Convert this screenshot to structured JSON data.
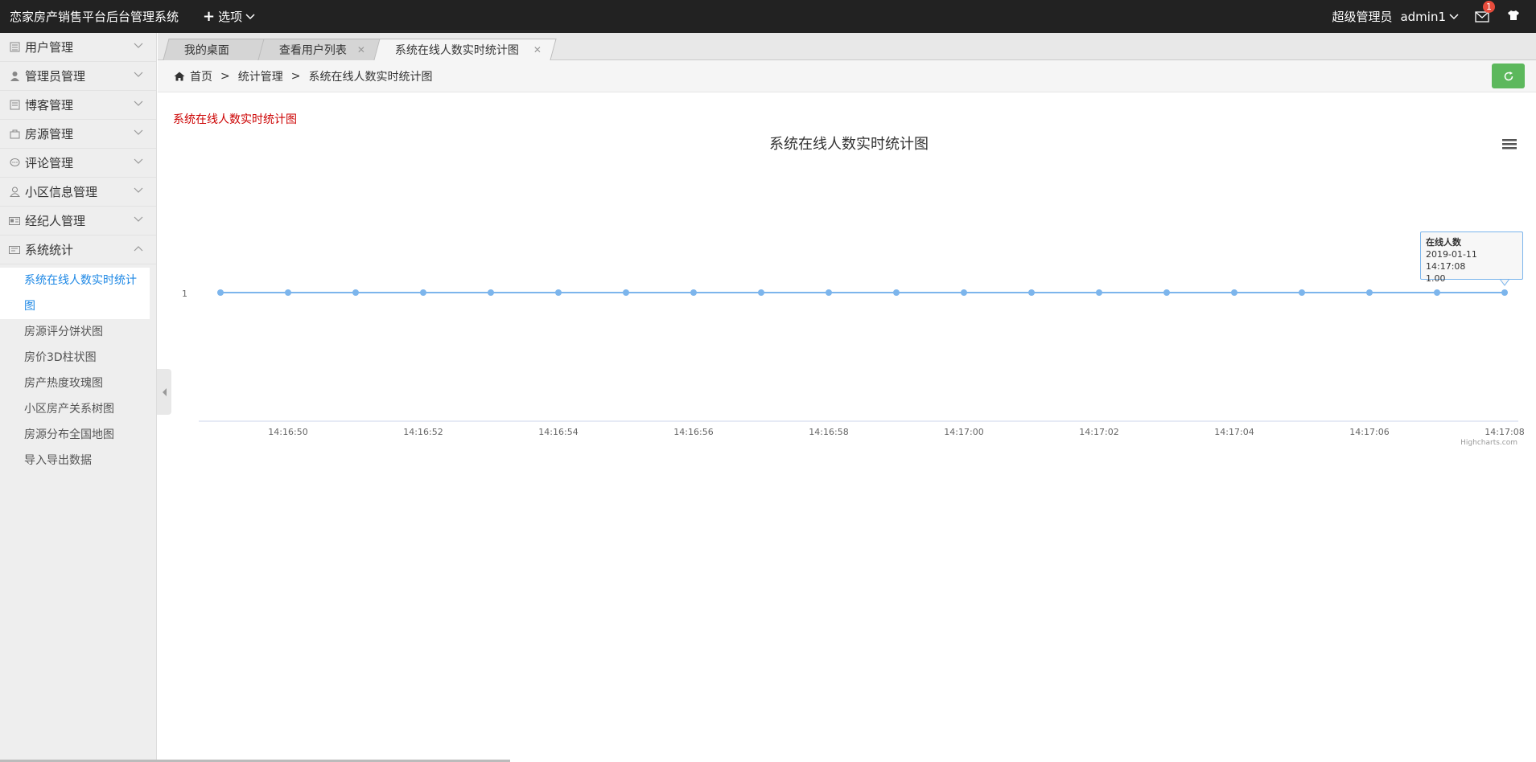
{
  "app": {
    "title": "恋家房产销售平台后台管理系统",
    "options_label": "选项"
  },
  "header": {
    "role": "超级管理员",
    "username": "admin1",
    "message_count": "1"
  },
  "sidebar": {
    "items": [
      {
        "label": "用户管理",
        "icon": "user-list-icon"
      },
      {
        "label": "管理员管理",
        "icon": "person-icon"
      },
      {
        "label": "博客管理",
        "icon": "blog-icon"
      },
      {
        "label": "房源管理",
        "icon": "bag-icon"
      },
      {
        "label": "评论管理",
        "icon": "comment-icon"
      },
      {
        "label": "小区信息管理",
        "icon": "user-outline-icon"
      },
      {
        "label": "经纪人管理",
        "icon": "id-card-icon"
      },
      {
        "label": "系统统计",
        "icon": "stats-icon"
      }
    ],
    "submenu": [
      "系统在线人数实时统计图",
      "房源评分饼状图",
      "房价3D柱状图",
      "房产热度玫瑰图",
      "小区房产关系树图",
      "房源分布全国地图",
      "导入导出数据"
    ]
  },
  "tabs": [
    {
      "label": "我的桌面"
    },
    {
      "label": "查看用户列表"
    },
    {
      "label": "系统在线人数实时统计图"
    }
  ],
  "breadcrumb": {
    "home": "首页",
    "level1": "统计管理",
    "level2": "系统在线人数实时统计图",
    "separator": ">"
  },
  "content": {
    "heading": "系统在线人数实时统计图"
  },
  "chart_data": {
    "type": "line",
    "title": "系统在线人数实时统计图",
    "series": [
      {
        "name": "在线人数",
        "color": "#7cb5ec",
        "x": [
          "14:16:49",
          "14:16:50",
          "14:16:51",
          "14:16:52",
          "14:16:53",
          "14:16:54",
          "14:16:55",
          "14:16:56",
          "14:16:57",
          "14:16:58",
          "14:16:59",
          "14:17:00",
          "14:17:01",
          "14:17:02",
          "14:17:03",
          "14:17:04",
          "14:17:05",
          "14:17:06",
          "14:17:07",
          "14:17:08"
        ],
        "values": [
          1,
          1,
          1,
          1,
          1,
          1,
          1,
          1,
          1,
          1,
          1,
          1,
          1,
          1,
          1,
          1,
          1,
          1,
          1,
          1
        ]
      }
    ],
    "x_tick_labels": [
      "14:16:50",
      "14:16:52",
      "14:16:54",
      "14:16:56",
      "14:16:58",
      "14:17:00",
      "14:17:02",
      "14:17:04",
      "14:17:06",
      "14:17:08"
    ],
    "y_tick_labels": [
      "1"
    ],
    "tooltip": {
      "series": "在线人数",
      "time": "2019-01-11 14:17:08",
      "value": "1.00"
    },
    "credits": "Highcharts.com"
  }
}
